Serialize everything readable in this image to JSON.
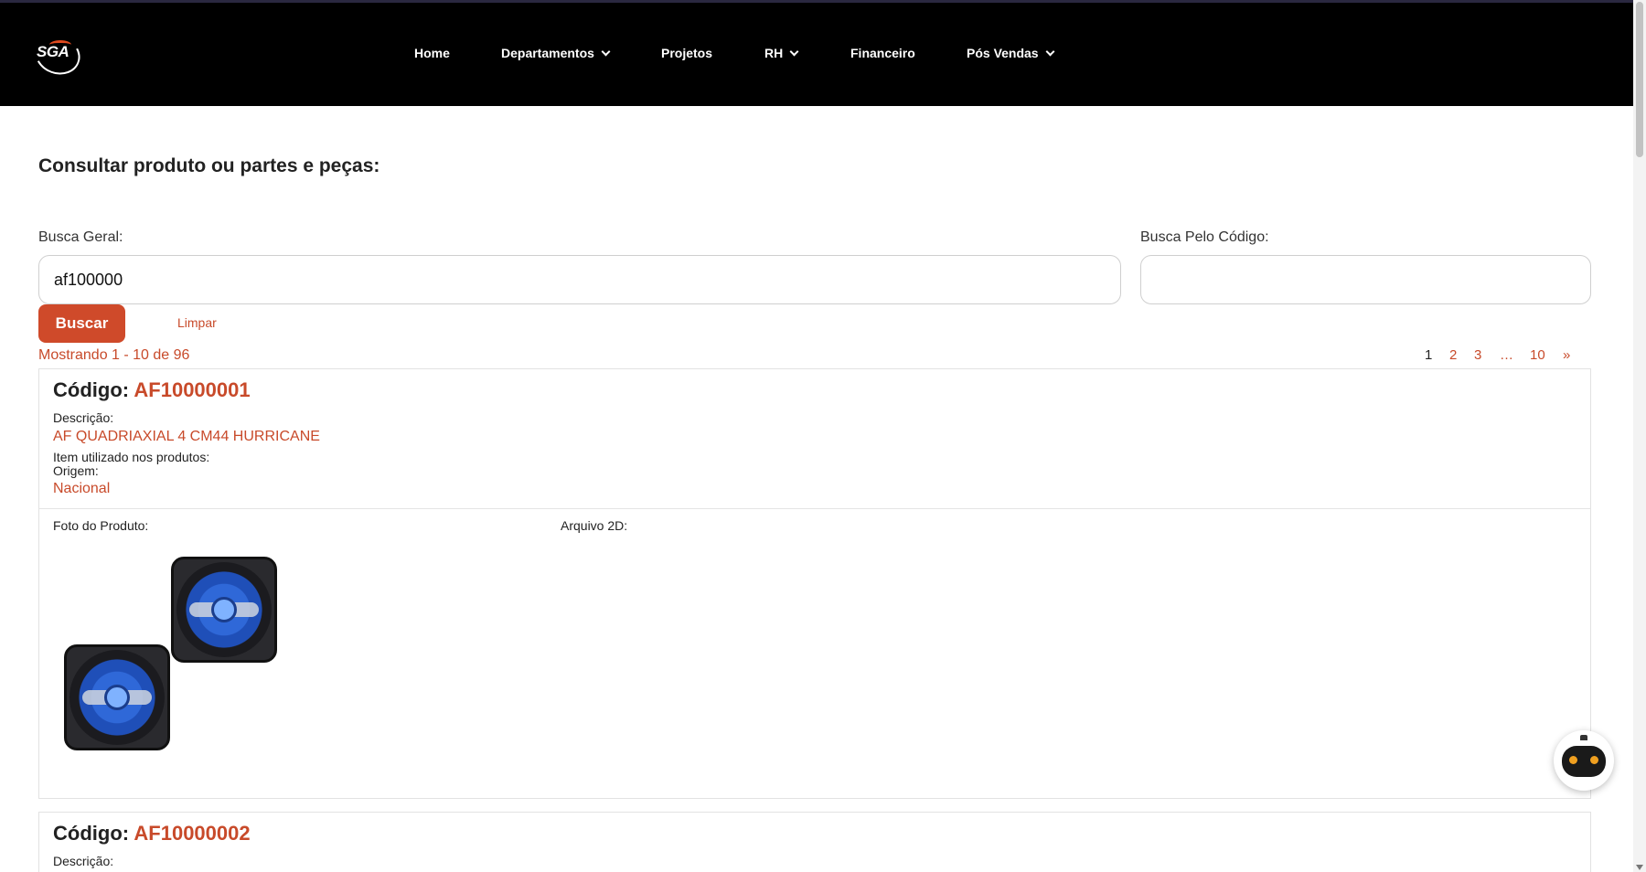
{
  "header": {
    "logo_text": "SGA",
    "nav": [
      {
        "label": "Home",
        "has_dropdown": false
      },
      {
        "label": "Departamentos",
        "has_dropdown": true
      },
      {
        "label": "Projetos",
        "has_dropdown": false
      },
      {
        "label": "RH",
        "has_dropdown": true
      },
      {
        "label": "Financeiro",
        "has_dropdown": false
      },
      {
        "label": "Pós Vendas",
        "has_dropdown": true
      }
    ]
  },
  "search": {
    "title": "Consultar produto ou partes e peças:",
    "general_label": "Busca Geral:",
    "general_value": "af100000",
    "code_label": "Busca Pelo Código:",
    "code_value": "",
    "search_button": "Buscar",
    "clear_button": "Limpar"
  },
  "results": {
    "showing": "Mostrando 1 - 10 de 96",
    "pagination": [
      "1",
      "2",
      "3",
      "…",
      "10",
      "»"
    ],
    "current_page": "1"
  },
  "products": [
    {
      "code_label": "Código:",
      "code": "AF10000001",
      "description_label": "Descrição:",
      "description": "AF QUADRIAXIAL 4 CM44 HURRICANE",
      "used_in_label": "Item utilizado nos produtos:",
      "origin_label": "Origem:",
      "origin": "Nacional",
      "photo_label": "Foto do Produto:",
      "file2d_label": "Arquivo 2D:"
    },
    {
      "code_label": "Código:",
      "code": "AF10000002",
      "description_label": "Descrição:"
    }
  ],
  "icons": {
    "nav_dropdown": "chevron-down-icon",
    "assistant": "robot-assistant-icon"
  },
  "colors": {
    "accent": "#cf4a2a",
    "header_bg": "#000000",
    "text": "#222222"
  }
}
